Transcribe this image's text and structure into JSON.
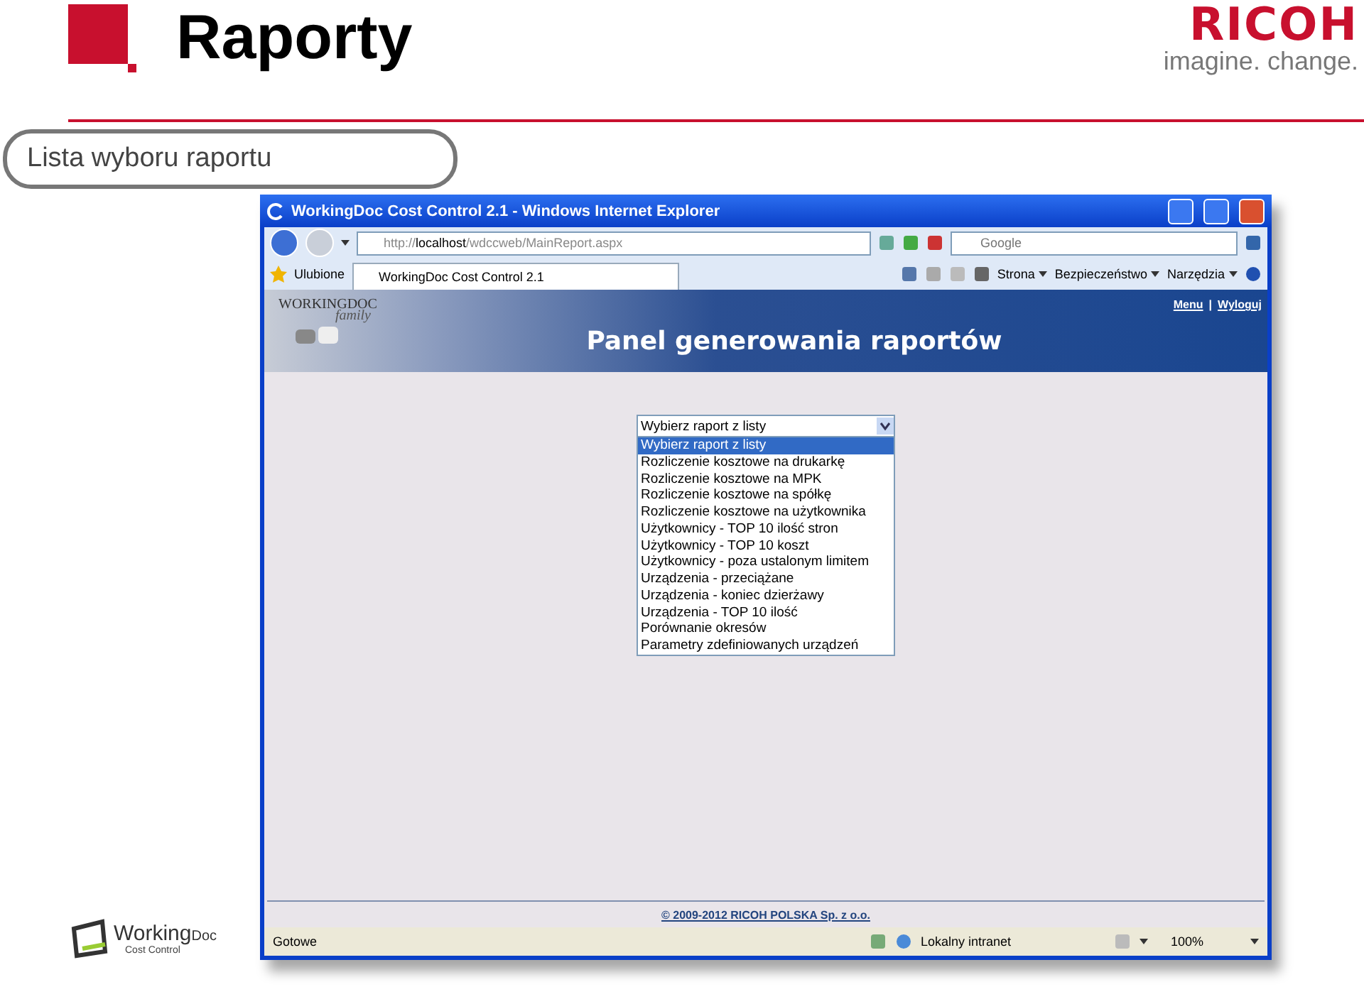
{
  "slide": {
    "title": "Raporty",
    "brand": "RICOH",
    "tagline": "imagine. change.",
    "caption": "Lista wyboru raportu"
  },
  "browser": {
    "title": "WorkingDoc Cost Control 2.1 - Windows Internet Explorer",
    "address": "http://**localhost**/wdccweb/MainReport.aspx",
    "search": {
      "placeholder": "Google"
    },
    "favorites": "Ulubione",
    "tab": "WorkingDoc Cost Control 2.1",
    "menus": [
      "Strona",
      "Bezpieczeństwo",
      "Narzędzia"
    ],
    "status": "Gotowe",
    "zone": "Lokalny intranet",
    "zoom": "100%"
  },
  "page": {
    "logo": {
      "word": "WORKINGDOC",
      "script": "family"
    },
    "links": [
      {
        "label": "Menu"
      },
      {
        "label": "Wyloguj"
      }
    ],
    "link_separator": "|",
    "heading": "Panel generowania raportów",
    "select": {
      "value": "Wybierz raport z listy",
      "options": [
        {
          "label": "Wybierz raport z listy",
          "selected": true
        },
        {
          "label": "Rozliczenie kosztowe na drukarkę",
          "selected": false
        },
        {
          "label": "Rozliczenie kosztowe na MPK",
          "selected": false
        },
        {
          "label": "Rozliczenie kosztowe na spółkę",
          "selected": false
        },
        {
          "label": "Rozliczenie kosztowe na użytkownika",
          "selected": false
        },
        {
          "label": "Użytkownicy - TOP 10 ilość stron",
          "selected": false
        },
        {
          "label": "Użytkownicy - TOP 10 koszt",
          "selected": false
        },
        {
          "label": "Użytkownicy - poza ustalonym limitem",
          "selected": false
        },
        {
          "label": "Urządzenia - przeciążane",
          "selected": false
        },
        {
          "label": "Urządzenia - koniec dzierżawy",
          "selected": false
        },
        {
          "label": "Urządzenia - TOP 10 ilość",
          "selected": false
        },
        {
          "label": "Porównanie okresów",
          "selected": false
        },
        {
          "label": "Parametry zdefiniowanych urządzeń",
          "selected": false
        }
      ]
    },
    "copyright": "© 2009-2012 RICOH POLSKA Sp. z o.o."
  },
  "footer_logo": {
    "word": "Working",
    "suffix": "Doc",
    "subtitle": "Cost Control"
  }
}
